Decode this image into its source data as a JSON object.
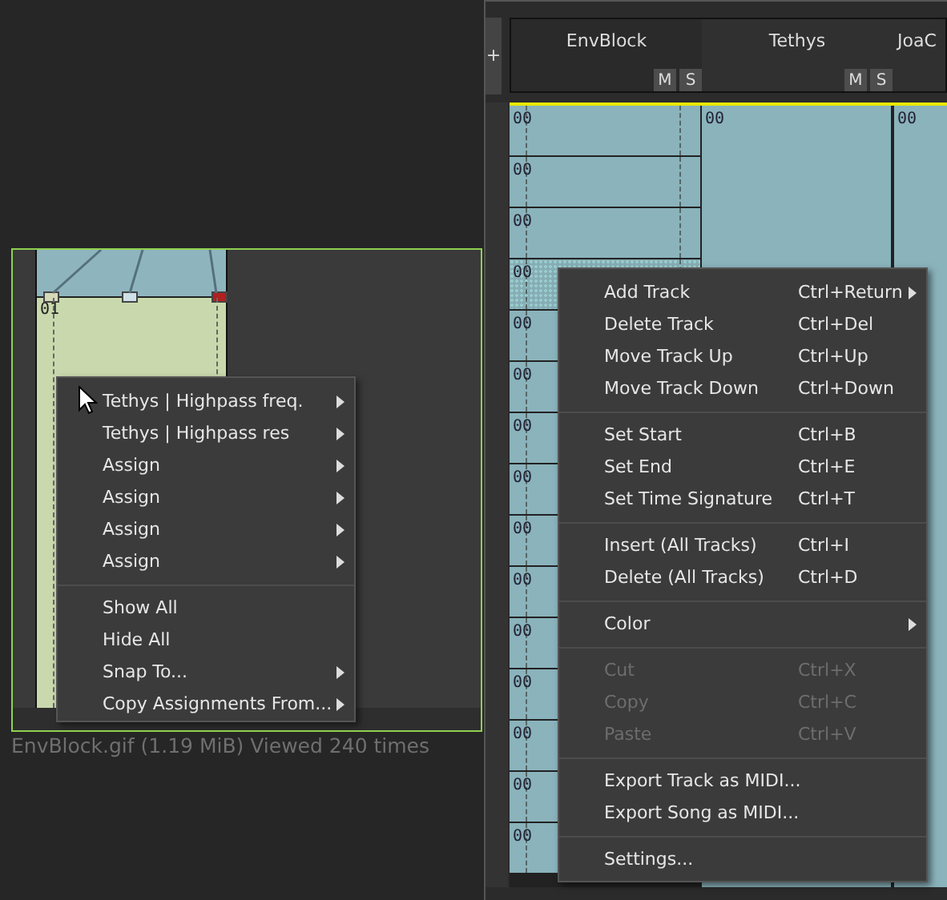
{
  "preview": {
    "track_label": "01",
    "menu": [
      {
        "kind": "item",
        "label": "Tethys | Highpass freq.",
        "submenu": true
      },
      {
        "kind": "item",
        "label": "Tethys | Highpass res",
        "submenu": true
      },
      {
        "kind": "item",
        "label": "Assign",
        "submenu": true
      },
      {
        "kind": "item",
        "label": "Assign",
        "submenu": true
      },
      {
        "kind": "item",
        "label": "Assign",
        "submenu": true
      },
      {
        "kind": "item",
        "label": "Assign",
        "submenu": true
      },
      {
        "kind": "separator"
      },
      {
        "kind": "item",
        "label": "Show All",
        "submenu": false
      },
      {
        "kind": "item",
        "label": "Hide All",
        "submenu": false
      },
      {
        "kind": "item",
        "label": "Snap To...",
        "submenu": true
      },
      {
        "kind": "item",
        "label": "Copy Assignments From...",
        "submenu": true
      }
    ],
    "caption": "EnvBlock.gif (1.19 MiB) Viewed 240 times"
  },
  "app": {
    "add_button": "+",
    "tracks": [
      {
        "name": "EnvBlock",
        "mute": "M",
        "solo": "S"
      },
      {
        "name": "Tethys",
        "mute": "M",
        "solo": "S"
      },
      {
        "name": "JoaC"
      }
    ],
    "column_1_cells": [
      {
        "text": "00",
        "selected": false
      },
      {
        "text": "00",
        "selected": false
      },
      {
        "text": "00",
        "selected": false
      },
      {
        "text": "00",
        "selected": true
      },
      {
        "text": "00",
        "selected": false
      },
      {
        "text": "00",
        "selected": false
      },
      {
        "text": "00",
        "selected": false
      },
      {
        "text": "00",
        "selected": false
      },
      {
        "text": "00",
        "selected": false
      },
      {
        "text": "00",
        "selected": false
      },
      {
        "text": "00",
        "selected": false
      },
      {
        "text": "00",
        "selected": false
      },
      {
        "text": "00",
        "selected": false
      },
      {
        "text": "00",
        "selected": false
      },
      {
        "text": "00",
        "selected": false
      }
    ],
    "column_2_cell": "00",
    "column_3_cell": "00",
    "menu": [
      {
        "kind": "item",
        "label": "Add Track",
        "shortcut": "Ctrl+Return",
        "submenu": true,
        "disabled": false
      },
      {
        "kind": "item",
        "label": "Delete Track",
        "shortcut": "Ctrl+Del",
        "submenu": false,
        "disabled": false
      },
      {
        "kind": "item",
        "label": "Move Track Up",
        "shortcut": "Ctrl+Up",
        "submenu": false,
        "disabled": false
      },
      {
        "kind": "item",
        "label": "Move Track Down",
        "shortcut": "Ctrl+Down",
        "submenu": false,
        "disabled": false
      },
      {
        "kind": "separator"
      },
      {
        "kind": "item",
        "label": "Set Start",
        "shortcut": "Ctrl+B",
        "submenu": false,
        "disabled": false
      },
      {
        "kind": "item",
        "label": "Set End",
        "shortcut": "Ctrl+E",
        "submenu": false,
        "disabled": false
      },
      {
        "kind": "item",
        "label": "Set Time Signature",
        "shortcut": "Ctrl+T",
        "submenu": false,
        "disabled": false
      },
      {
        "kind": "separator"
      },
      {
        "kind": "item",
        "label": "Insert (All Tracks)",
        "shortcut": "Ctrl+I",
        "submenu": false,
        "disabled": false
      },
      {
        "kind": "item",
        "label": "Delete (All Tracks)",
        "shortcut": "Ctrl+D",
        "submenu": false,
        "disabled": false
      },
      {
        "kind": "separator"
      },
      {
        "kind": "item",
        "label": "Color",
        "submenu": true,
        "disabled": false
      },
      {
        "kind": "separator"
      },
      {
        "kind": "item",
        "label": "Cut",
        "shortcut": "Ctrl+X",
        "submenu": false,
        "disabled": true
      },
      {
        "kind": "item",
        "label": "Copy",
        "shortcut": "Ctrl+C",
        "submenu": false,
        "disabled": true
      },
      {
        "kind": "item",
        "label": "Paste",
        "shortcut": "Ctrl+V",
        "submenu": false,
        "disabled": true
      },
      {
        "kind": "separator"
      },
      {
        "kind": "item",
        "label": "Export Track as MIDI...",
        "submenu": false,
        "disabled": false
      },
      {
        "kind": "item",
        "label": "Export Song as MIDI...",
        "submenu": false,
        "disabled": false
      },
      {
        "kind": "separator"
      },
      {
        "kind": "item",
        "label": "Settings...",
        "submenu": false,
        "disabled": false
      }
    ]
  }
}
